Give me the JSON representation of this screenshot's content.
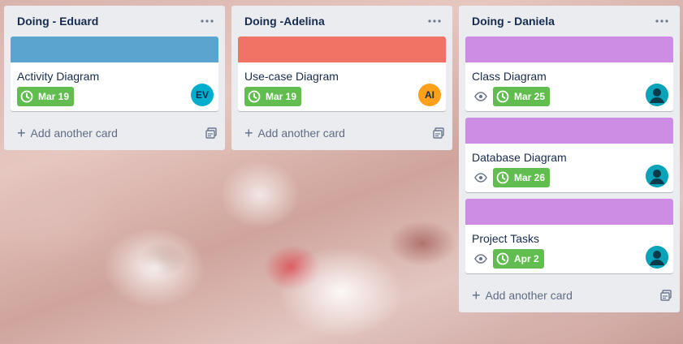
{
  "colors": {
    "blue_cover": "#5ba4cf",
    "red_cover": "#f07366",
    "purple_cover": "#cd8de5",
    "due_green": "#61bd4f",
    "list_bg": "#ebecf0"
  },
  "lists": [
    {
      "title": "Doing - Eduard",
      "cards": [
        {
          "title": "Activity Diagram",
          "due": "Mar 19",
          "avatar": "EV",
          "cover_color": "#5ba4cf"
        }
      ],
      "add_label": "Add another card"
    },
    {
      "title": "Doing -Adelina",
      "cards": [
        {
          "title": "Use-case Diagram",
          "due": "Mar 19",
          "avatar": "AI",
          "cover_color": "#f07366"
        }
      ],
      "add_label": "Add another card"
    },
    {
      "title": "Doing - Daniela",
      "cards": [
        {
          "title": "Class Diagram",
          "due": "Mar 25",
          "cover_color": "#cd8de5"
        },
        {
          "title": "Database Diagram",
          "due": "Mar 26",
          "cover_color": "#cd8de5"
        },
        {
          "title": "Project Tasks",
          "due": "Apr 2",
          "cover_color": "#cd8de5"
        }
      ],
      "add_label": "Add another card"
    }
  ],
  "icons": {
    "list_menu": "ellipsis-icon",
    "due": "clock-icon",
    "watch": "eye-icon",
    "add": "plus-icon",
    "template": "card-template-icon",
    "avatar_default": "user-avatar-icon"
  }
}
